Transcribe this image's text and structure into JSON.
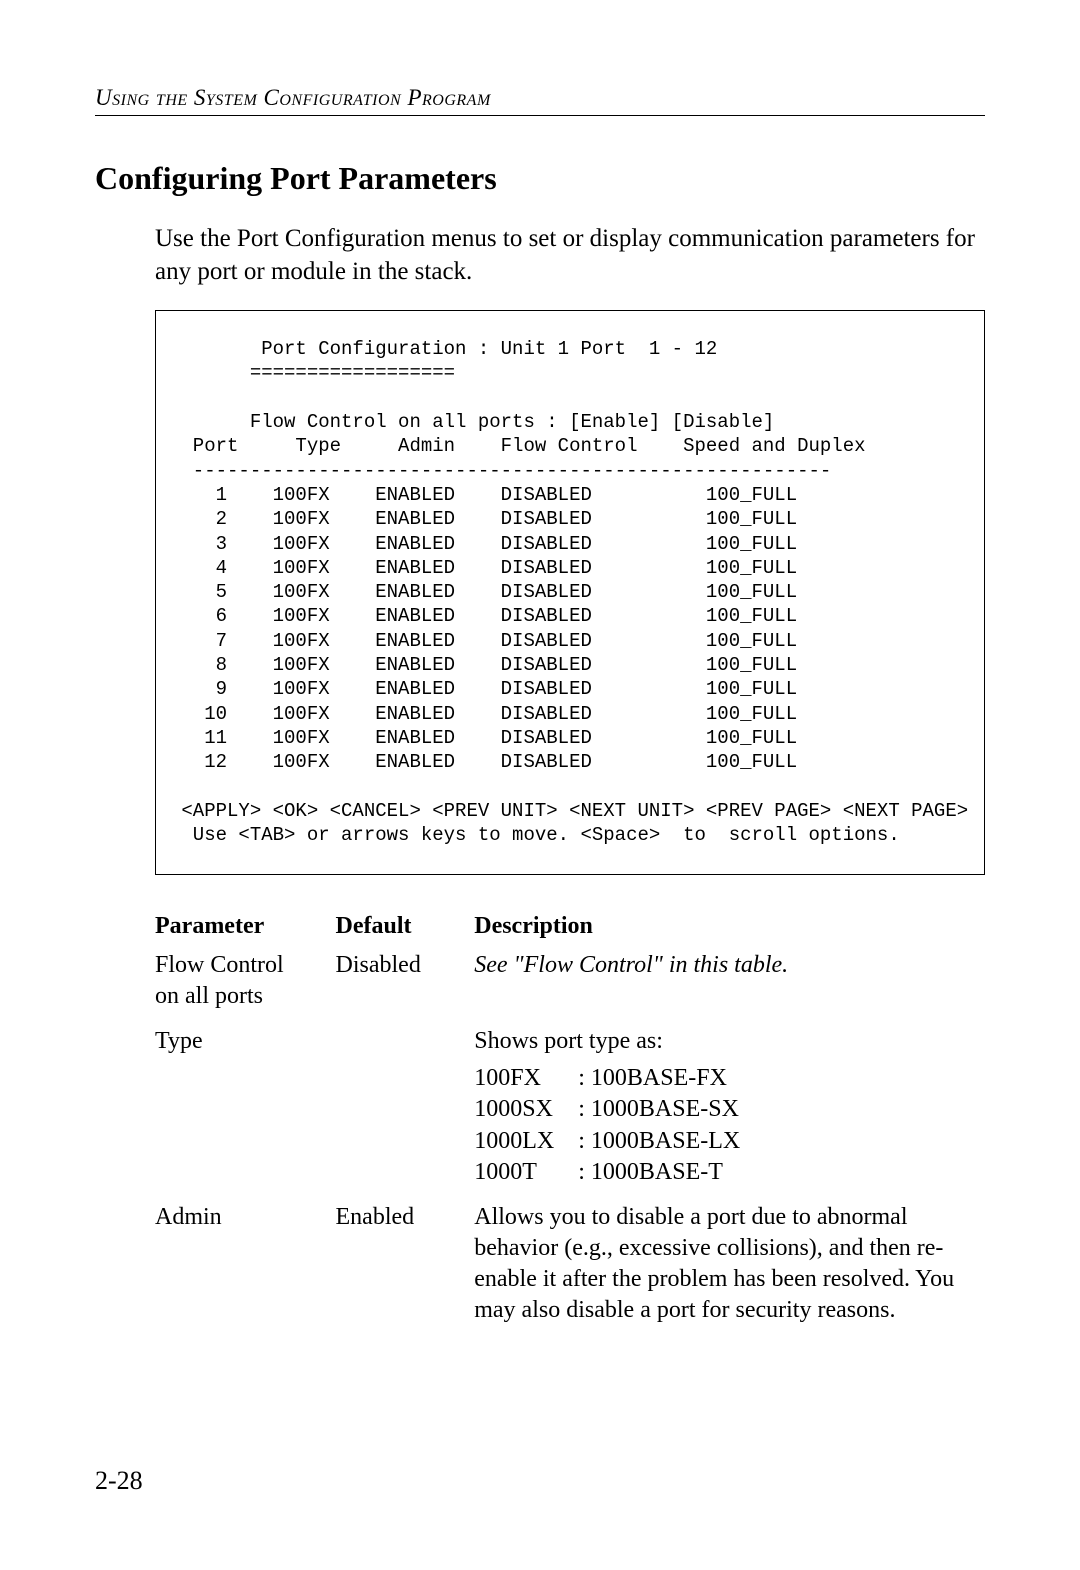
{
  "header": {
    "running": "Using the System Configuration Program"
  },
  "section": {
    "title": "Configuring Port Parameters",
    "intro": "Use the Port Configuration menus to set or display communication parameters for any port or module in the stack."
  },
  "terminal": {
    "title": "Port Configuration : Unit 1 Port  1 - 12",
    "rule": "==================",
    "flow_line": "Flow Control on all ports : [Enable] [Disable]",
    "columns_line": "  Port     Type     Admin    Flow Control    Speed and Duplex",
    "dash_line": "  --------------------------------------------------------",
    "rows": [
      {
        "port": "1",
        "type": "100FX",
        "admin": "ENABLED",
        "flow": "DISABLED",
        "speed": "100_FULL"
      },
      {
        "port": "2",
        "type": "100FX",
        "admin": "ENABLED",
        "flow": "DISABLED",
        "speed": "100_FULL"
      },
      {
        "port": "3",
        "type": "100FX",
        "admin": "ENABLED",
        "flow": "DISABLED",
        "speed": "100_FULL"
      },
      {
        "port": "4",
        "type": "100FX",
        "admin": "ENABLED",
        "flow": "DISABLED",
        "speed": "100_FULL"
      },
      {
        "port": "5",
        "type": "100FX",
        "admin": "ENABLED",
        "flow": "DISABLED",
        "speed": "100_FULL"
      },
      {
        "port": "6",
        "type": "100FX",
        "admin": "ENABLED",
        "flow": "DISABLED",
        "speed": "100_FULL"
      },
      {
        "port": "7",
        "type": "100FX",
        "admin": "ENABLED",
        "flow": "DISABLED",
        "speed": "100_FULL"
      },
      {
        "port": "8",
        "type": "100FX",
        "admin": "ENABLED",
        "flow": "DISABLED",
        "speed": "100_FULL"
      },
      {
        "port": "9",
        "type": "100FX",
        "admin": "ENABLED",
        "flow": "DISABLED",
        "speed": "100_FULL"
      },
      {
        "port": "10",
        "type": "100FX",
        "admin": "ENABLED",
        "flow": "DISABLED",
        "speed": "100_FULL"
      },
      {
        "port": "11",
        "type": "100FX",
        "admin": "ENABLED",
        "flow": "DISABLED",
        "speed": "100_FULL"
      },
      {
        "port": "12",
        "type": "100FX",
        "admin": "ENABLED",
        "flow": "DISABLED",
        "speed": "100_FULL"
      }
    ],
    "nav_line": " <APPLY> <OK> <CANCEL> <PREV UNIT> <NEXT UNIT> <PREV PAGE> <NEXT PAGE>",
    "hint_line": "  Use <TAB> or arrows keys to move. <Space>  to  scroll options."
  },
  "param_table": {
    "headers": {
      "param": "Parameter",
      "default": "Default",
      "desc": "Description"
    },
    "rows": [
      {
        "param": "Flow Control on all ports",
        "default": "Disabled",
        "desc_italic": "See \"Flow Control\" in this table."
      },
      {
        "param": "Type",
        "default": "",
        "desc_plain": "Shows port type as:",
        "types": [
          {
            "code": "100FX",
            "name": ": 100BASE-FX"
          },
          {
            "code": "1000SX",
            "name": ": 1000BASE-SX"
          },
          {
            "code": "1000LX",
            "name": ": 1000BASE-LX"
          },
          {
            "code": "1000T",
            "name": ": 1000BASE-T"
          }
        ]
      },
      {
        "param": "Admin",
        "default": "Enabled",
        "desc_plain": "Allows you to disable a port due to abnormal behavior (e.g., excessive collisions), and then re-enable it after the problem has been resolved. You may also disable a port for security reasons."
      }
    ]
  },
  "page_number": "2-28"
}
